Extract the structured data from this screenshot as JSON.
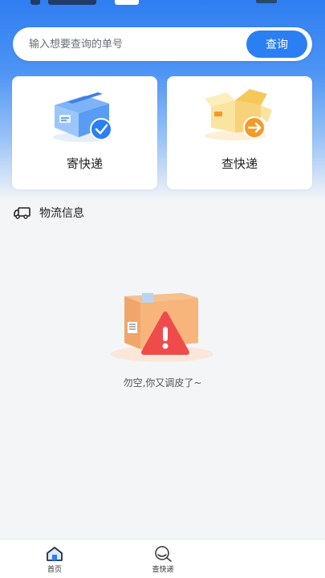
{
  "search": {
    "placeholder": "输入想要查询的单号",
    "button_label": "查询"
  },
  "cards": [
    {
      "label": "寄快递",
      "icon": "send-package-icon"
    },
    {
      "label": "查快递",
      "icon": "track-package-icon"
    }
  ],
  "logistics": {
    "title": "物流信息",
    "empty_text": "勿空,你又调皮了~"
  },
  "tabbar": {
    "items": [
      {
        "label": "首页",
        "icon": "home-icon",
        "active": true
      },
      {
        "label": "查快递",
        "icon": "search-icon",
        "active": false
      }
    ]
  },
  "colors": {
    "primary": "#2a7ff3",
    "background": "#f4f5f7",
    "warning": "#ef4b4b",
    "accent_orange": "#f39a2a"
  }
}
